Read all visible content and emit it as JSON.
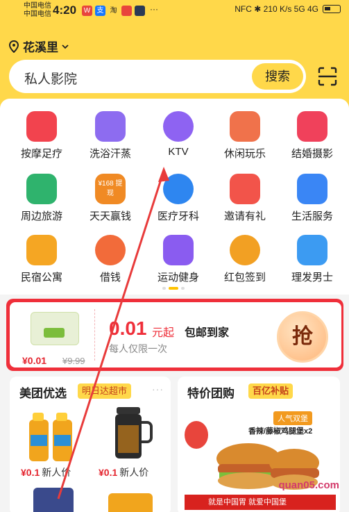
{
  "status_bar": {
    "carrier_1": "中国电信",
    "carrier_2": "中国电信",
    "time": "4:20",
    "app_icons": [
      "W",
      "支",
      "淘",
      "",
      ""
    ],
    "right_text": "NFC  ✱  210 K/s  5G  4G"
  },
  "header": {
    "location": "花溪里",
    "search_placeholder": "私人影院",
    "search_button": "搜索"
  },
  "categories": [
    {
      "label": "按摩足疗",
      "icon": "foot-icon",
      "color": "#f2434e"
    },
    {
      "label": "洗浴汗蒸",
      "icon": "bath-icon",
      "color": "#8d6cf0"
    },
    {
      "label": "KTV",
      "icon": "microphone-icon",
      "color": "#8e63f2"
    },
    {
      "label": "休闲玩乐",
      "icon": "entertainment-icon",
      "color": "#f0724b"
    },
    {
      "label": "结婚摄影",
      "icon": "heart-icon",
      "color": "#f0415b"
    },
    {
      "label": "周边旅游",
      "icon": "palm-tree-icon",
      "color": "#2fb36d"
    },
    {
      "label": "天天赢钱",
      "icon": "coupon-icon",
      "color": "#f08a24",
      "icon_text": "¥168 提现"
    },
    {
      "label": "医疗牙科",
      "icon": "medical-icon",
      "color": "#2e86f0"
    },
    {
      "label": "邀请有礼",
      "icon": "gift-icon",
      "color": "#f2544a"
    },
    {
      "label": "生活服务",
      "icon": "tools-icon",
      "color": "#3a86f5"
    },
    {
      "label": "民宿公寓",
      "icon": "house-icon",
      "color": "#f5a623"
    },
    {
      "label": "借钱",
      "icon": "wallet-icon",
      "color": "#f26b3a"
    },
    {
      "label": "运动健身",
      "icon": "dumbbell-icon",
      "color": "#8a5cf0"
    },
    {
      "label": "红包签到",
      "icon": "money-bag-icon",
      "color": "#f2a023"
    },
    {
      "label": "理发男士",
      "icon": "barber-icon",
      "color": "#3c9bf2"
    }
  ],
  "promo": {
    "price_big": "0.01",
    "unit": "元起",
    "shipping": "包邮到家",
    "limit": "每人仅限一次",
    "price_small": "¥0.01",
    "strike_price": "¥9.99",
    "grab_button": "抢"
  },
  "card_left": {
    "title": "美团优选",
    "tag": "明日达超市",
    "items": [
      {
        "price": "¥0.1",
        "label": "新人价"
      },
      {
        "price": "¥0.1",
        "label": "新人价"
      }
    ]
  },
  "card_right": {
    "title": "特价团购",
    "tag": "百亿补贴",
    "banner_badge": "人气双堡",
    "banner_text": "香辣/藤椒鸡腿堡x2",
    "banner_footer": "就是中国胃 就爱中国堡"
  },
  "watermark": "quan05.com",
  "colors": {
    "brand_yellow": "#ffd84a",
    "promo_red": "#ef2f3a"
  }
}
